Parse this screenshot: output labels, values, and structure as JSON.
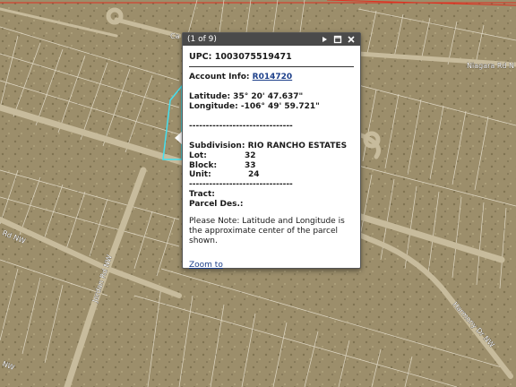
{
  "map": {
    "road_labels": {
      "niagara": "Niagara Rd N",
      "jordan": "Jordan Rd NW",
      "harmony": "Harmony Dr NW",
      "rd_nw": "Rd NW",
      "nw": "NW",
      "ca": "Ca"
    },
    "colors": {
      "terrain": "#9c8e6b",
      "parcel_line": "#ece6d6",
      "road": "#c7bb9c",
      "highlight": "#44e0f0",
      "boundary": "#e03020"
    }
  },
  "popup": {
    "counter": "(1 of 9)",
    "upc": "UPC: 1003075519471",
    "account_label": "Account Info:",
    "account_link": "R014720",
    "latitude": "Latitude: 35° 20' 47.637\"",
    "longitude": "Longitude: -106° 49' 59.721\"",
    "separator1": "-------------------------------",
    "subdivision": "Subdivision: RIO RANCHO ESTATES",
    "lot_label": "Lot:",
    "lot_value": "32",
    "block_label": "Block:",
    "block_value": "33",
    "unit_label": "Unit:",
    "unit_value": "24",
    "separator2": "-------------------------------",
    "tract": "Tract:",
    "parcel_des": "Parcel Des.:",
    "note": "Please Note: Latitude and Longitude is the approximate center of the parcel shown.",
    "zoom_link": "Zoom to",
    "icons": [
      "next-icon",
      "maximize-icon",
      "close-icon"
    ]
  }
}
